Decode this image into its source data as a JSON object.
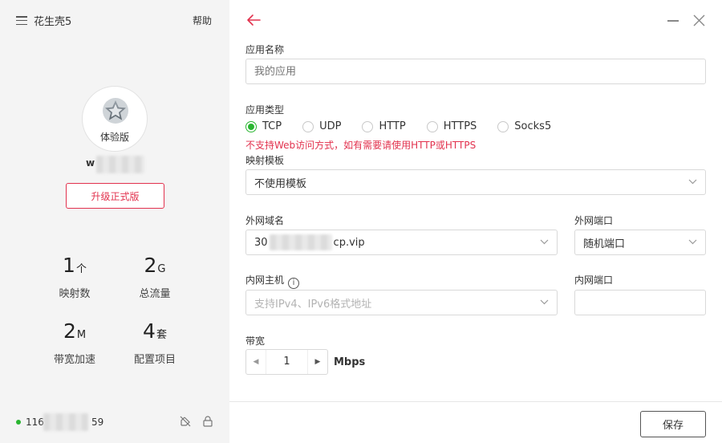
{
  "app": {
    "title": "花生壳5",
    "help_label": "帮助"
  },
  "profile": {
    "badge": "体验版",
    "username": "w",
    "upgrade_label": "升级正式版"
  },
  "stats": [
    {
      "value": "1",
      "unit": "个",
      "label": "映射数"
    },
    {
      "value": "2",
      "unit": "G",
      "label": "总流量"
    },
    {
      "value": "2",
      "unit": "M",
      "label": "带宽加速"
    },
    {
      "value": "4",
      "unit": "套",
      "label": "配置项目"
    }
  ],
  "footer": {
    "ip_start": "116",
    "ip_end": "59",
    "status_color": "#29b530"
  },
  "form": {
    "app_name": {
      "label": "应用名称",
      "placeholder": "我的应用",
      "value": ""
    },
    "app_type": {
      "label": "应用类型",
      "options": [
        "TCP",
        "UDP",
        "HTTP",
        "HTTPS",
        "Socks5"
      ],
      "selected": "TCP",
      "warning": "不支持Web访问方式，如有需要请使用HTTP或HTTPS"
    },
    "template": {
      "label": "映射模板",
      "value": "不使用模板"
    },
    "domain": {
      "label": "外网域名",
      "value_start": "30",
      "value_end": "cp.vip"
    },
    "external_port": {
      "label": "外网端口",
      "value": "随机端口"
    },
    "internal_host": {
      "label": "内网主机",
      "placeholder": "支持IPv4、IPv6格式地址"
    },
    "internal_port": {
      "label": "内网端口",
      "value": ""
    },
    "bandwidth": {
      "label": "带宽",
      "value": "1",
      "unit": "Mbps"
    },
    "save_label": "保存"
  },
  "colors": {
    "accent": "#e2324e",
    "success": "#29b530"
  },
  "icons": [
    "menu-icon",
    "star-icon",
    "back-arrow-icon",
    "minimize-icon",
    "close-icon",
    "chevron-down-icon",
    "info-icon",
    "share-icon",
    "lock-icon"
  ]
}
